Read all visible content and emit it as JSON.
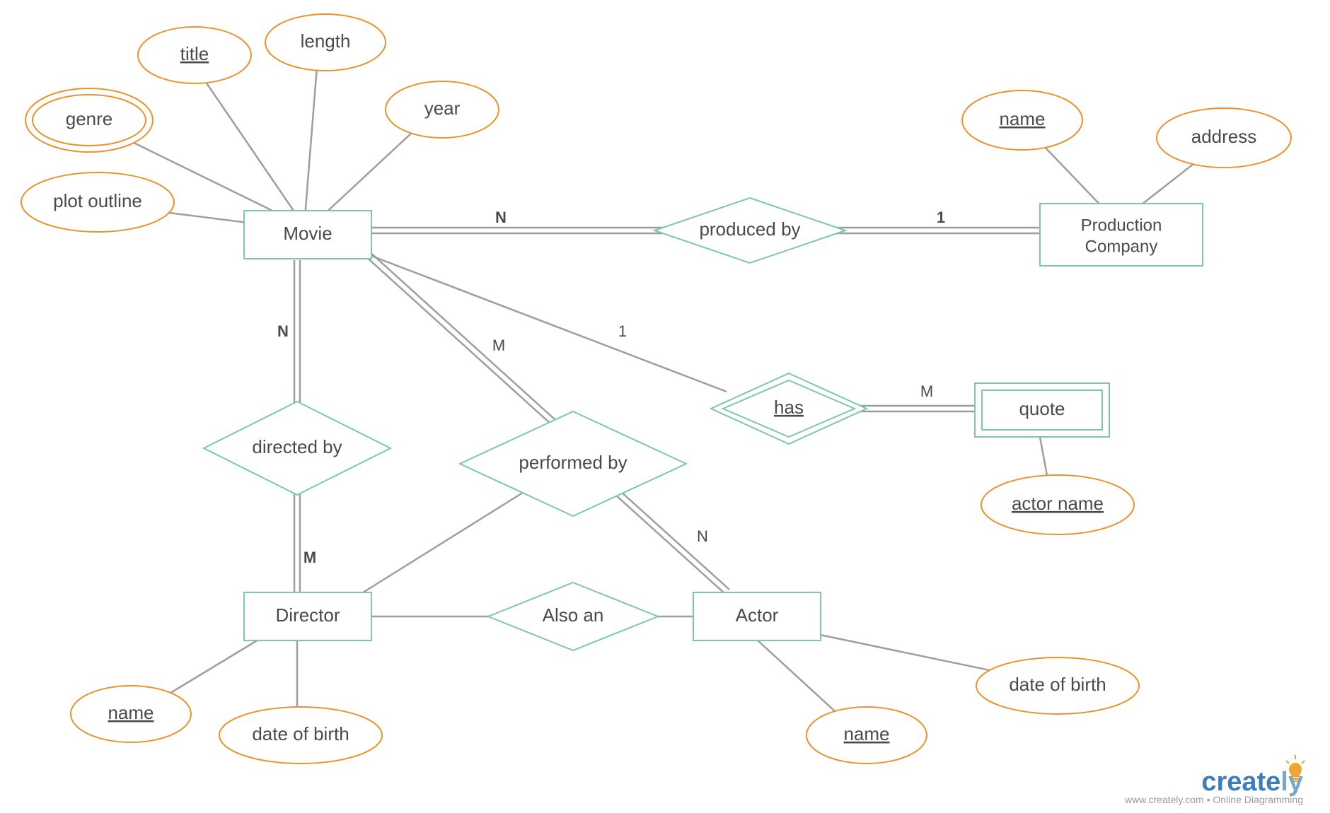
{
  "entities": {
    "movie": "Movie",
    "production_company_l1": "Production",
    "production_company_l2": "Company",
    "director": "Director",
    "actor": "Actor",
    "quote": "quote"
  },
  "relationships": {
    "produced_by": "produced by",
    "directed_by": "directed by",
    "performed_by": "performed by",
    "has": "has",
    "also_an": "Also an"
  },
  "attributes": {
    "genre": "genre",
    "title": "title",
    "length": "length",
    "year": "year",
    "plot_outline": "plot outline",
    "pc_name": "name",
    "pc_address": "address",
    "quote_actor_name": "actor name",
    "director_name": "name",
    "director_dob": "date of birth",
    "actor_name": "name",
    "actor_dob": "date of birth"
  },
  "cardinalities": {
    "movie_produced": "N",
    "pc_produced": "1",
    "movie_directed": "N",
    "director_directed": "M",
    "movie_performed": "M",
    "actor_performed": "N",
    "movie_has": "1",
    "quote_has": "M"
  },
  "branding": {
    "name_part1": "create",
    "name_part2": "ly",
    "tagline": "www.creately.com • Online Diagramming"
  }
}
